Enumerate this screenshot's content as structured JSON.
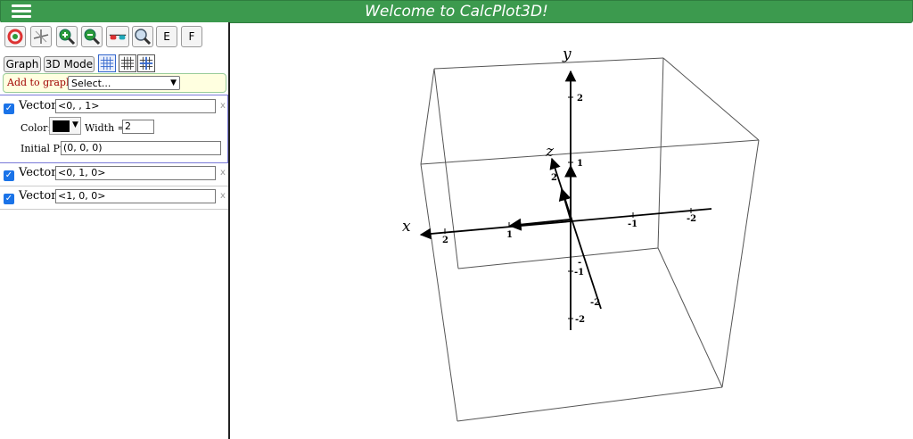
{
  "header": {
    "title": "Welcome to CalcPlot3D!"
  },
  "toolbar": {
    "buttons": [
      {
        "name": "reset-view-icon"
      },
      {
        "name": "axes-icon"
      },
      {
        "name": "zoom-in-icon"
      },
      {
        "name": "zoom-out-icon"
      },
      {
        "name": "3d-glasses-icon"
      },
      {
        "name": "magnifier-icon"
      },
      {
        "name": "e-button",
        "label": "E"
      },
      {
        "name": "f-button",
        "label": "F"
      }
    ],
    "graph_label": "Graph",
    "mode_label": "3D Mode"
  },
  "add_to_graph": {
    "label": "Add to graph:",
    "selected": "Select..."
  },
  "objects": [
    {
      "type_label": "Vector:",
      "value": "<0, , 1>",
      "color_label": "Color:",
      "width_label": "Width =",
      "width_value": "2",
      "initial_label": "Initial Pt:",
      "initial_value": "(0, 0, 0)"
    },
    {
      "type_label": "Vector:",
      "value": "<0, 1, 0>"
    },
    {
      "type_label": "Vector:",
      "value": "<1, 0, 0>"
    }
  ],
  "plot": {
    "axis_labels": {
      "x": "x",
      "y": "y",
      "z": "z"
    },
    "x_ticks": [
      "2",
      "1",
      "-1",
      "-2"
    ],
    "y_ticks": [
      "2",
      "1",
      "-1",
      "-2"
    ],
    "z_ticks": [
      "2",
      "-2"
    ],
    "extra_tick": "-"
  }
}
